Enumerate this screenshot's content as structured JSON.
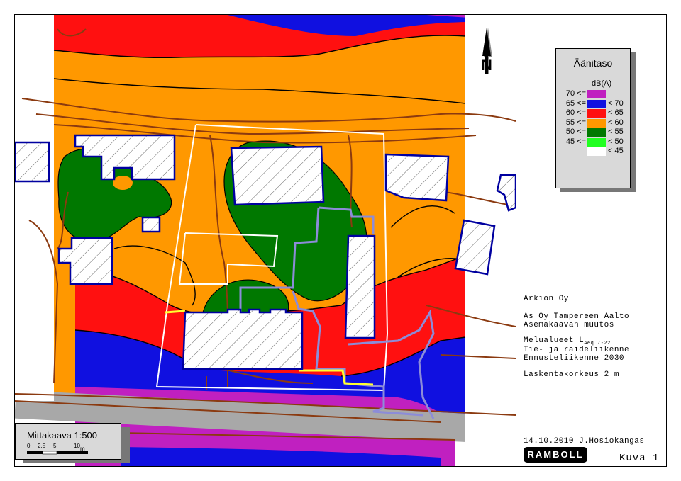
{
  "legend": {
    "title": "Äänitaso",
    "unit": "dB(A)",
    "rows": [
      {
        "lo": "70 <=",
        "hi": "",
        "color": "#c020c0"
      },
      {
        "lo": "65 <=",
        "hi": "< 70",
        "color": "#1010e0"
      },
      {
        "lo": "60 <=",
        "hi": "< 65",
        "color": "#ff1010"
      },
      {
        "lo": "55 <=",
        "hi": "< 60",
        "color": "#ff9800"
      },
      {
        "lo": "50 <=",
        "hi": "< 55",
        "color": "#007800"
      },
      {
        "lo": "45 <=",
        "hi": "< 50",
        "color": "#20ff20"
      },
      {
        "lo": "",
        "hi": "< 45",
        "color": "#ffffff"
      }
    ]
  },
  "info": {
    "company": "Arkion Oy",
    "project_line1": "As Oy Tampereen Aalto",
    "project_line2": "Asemakaavan muutos",
    "map_type_prefix": "Melualueet L",
    "map_type_sub": "Aeq 7-22",
    "traffic": "Tie- ja raideliikenne",
    "forecast": "Ennusteliikenne 2030",
    "height": "Laskentakorkeus 2 m",
    "date_author": "14.10.2010 J.Hosiokangas",
    "logo": "RAMBOLL",
    "figure": "Kuva 1"
  },
  "scale": {
    "title": "Mittakaava 1:500",
    "ticks": [
      "0",
      "2,5",
      "5",
      "10"
    ],
    "unit": "m"
  },
  "north_label": "N"
}
